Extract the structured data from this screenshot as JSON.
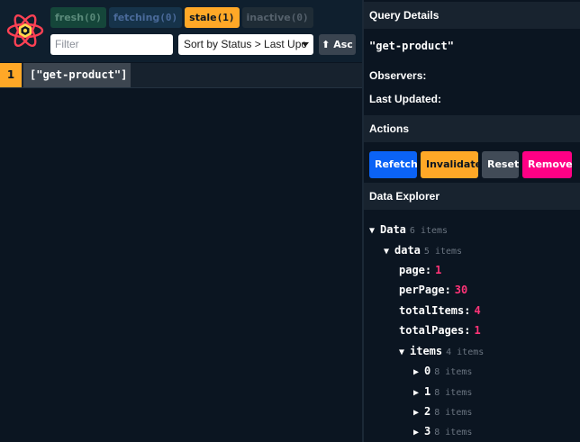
{
  "header": {
    "badges": [
      {
        "label": "fresh",
        "count": "(0)"
      },
      {
        "label": "fetching",
        "count": "(0)"
      },
      {
        "label": "stale",
        "count": "(1)"
      },
      {
        "label": "inactive",
        "count": "(0)"
      }
    ],
    "filter_placeholder": "Filter",
    "sort_value": "Sort by Status > Last Upc",
    "asc_label": "⬆ Asc"
  },
  "queries": [
    {
      "observers": "1",
      "key": "[\"get-product\"]"
    }
  ],
  "details": {
    "title": "Query Details",
    "query_key": "\"get-product\"",
    "observers_label": "Observers:",
    "last_updated_label": "Last Updated:"
  },
  "actions": {
    "title": "Actions",
    "refetch": "Refetch",
    "invalidate": "Invalidate",
    "reset": "Reset",
    "remove": "Remove"
  },
  "explorer": {
    "title": "Data Explorer",
    "rows": [
      {
        "tri": "▼",
        "key": "Data",
        "count": "6 items",
        "value": ""
      },
      {
        "tri": "▼",
        "key": "data",
        "count": "5 items",
        "value": ""
      },
      {
        "tri": "",
        "key": "page:",
        "count": "",
        "value": "1"
      },
      {
        "tri": "",
        "key": "perPage:",
        "count": "",
        "value": "30"
      },
      {
        "tri": "",
        "key": "totalItems:",
        "count": "",
        "value": "4"
      },
      {
        "tri": "",
        "key": "totalPages:",
        "count": "",
        "value": "1"
      },
      {
        "tri": "▼",
        "key": "items",
        "count": "4 items",
        "value": ""
      },
      {
        "tri": "▶",
        "key": "0",
        "count": "8 items",
        "value": ""
      },
      {
        "tri": "▶",
        "key": "1",
        "count": "8 items",
        "value": ""
      },
      {
        "tri": "▶",
        "key": "2",
        "count": "8 items",
        "value": ""
      },
      {
        "tri": "▶",
        "key": "3",
        "count": "8 items",
        "value": ""
      }
    ]
  },
  "colors": {
    "background": "#0b1521",
    "stale": "#ffa827",
    "refetch": "#0b63f6",
    "remove": "#ff0085",
    "value": "#ff3478"
  }
}
